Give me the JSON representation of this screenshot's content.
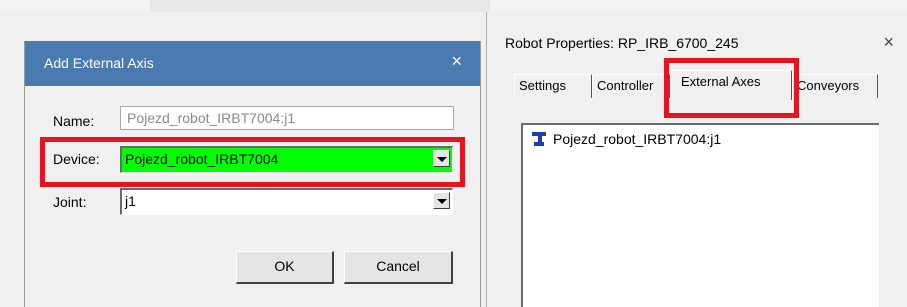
{
  "left_dialog": {
    "title": "Add External Axis",
    "close_glyph": "×",
    "name_label": "Name:",
    "name_value": "Pojezd_robot_IRBT7004:j1",
    "device_label": "Device:",
    "device_value": "Pojezd_robot_IRBT7004",
    "joint_label": "Joint:",
    "joint_value": "j1",
    "ok_label": "OK",
    "cancel_label": "Cancel"
  },
  "right_dialog": {
    "title": "Robot Properties: RP_IRB_6700_245",
    "close_glyph": "×",
    "tabs": [
      {
        "label": "Settings"
      },
      {
        "label": "Controller"
      },
      {
        "label": "External Axes"
      },
      {
        "label": "Conveyors"
      }
    ],
    "list_items": [
      {
        "label": "Pojezd_robot_IRBT7004:j1",
        "icon": "robot-axis-icon"
      }
    ]
  },
  "colors": {
    "titlebar": "#4a7bb0",
    "highlight": "#e5141e",
    "device_selected_bg": "#00ff00"
  }
}
